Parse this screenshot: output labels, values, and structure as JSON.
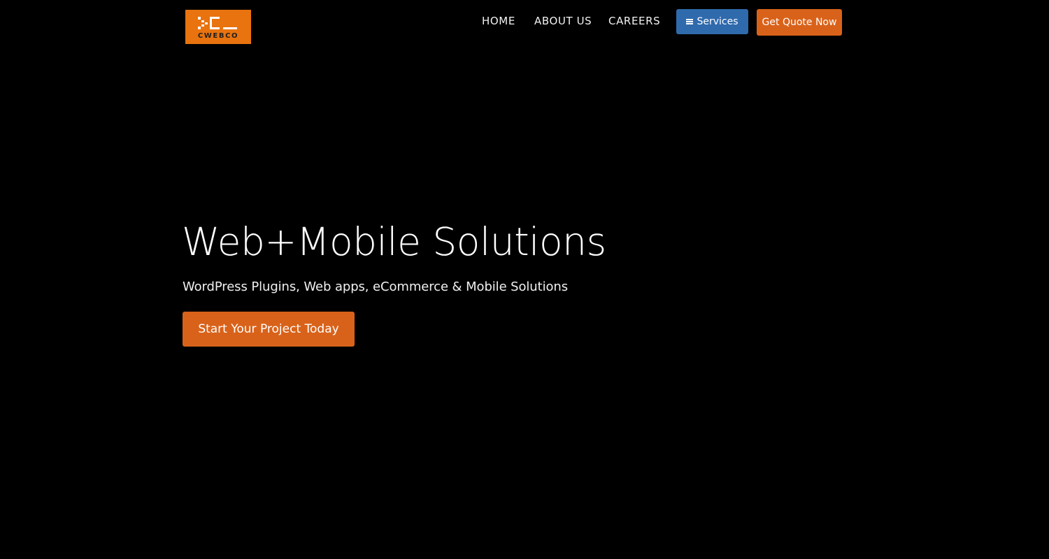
{
  "brand": {
    "logo_text": "CWEBCO",
    "logo_color": "#e8730f"
  },
  "nav": {
    "items": [
      {
        "label": "HOME"
      },
      {
        "label": "ABOUT US"
      },
      {
        "label": "CAREERS"
      }
    ],
    "services_label": "Services",
    "services_icon": "menu-icon",
    "quote_label": "Get Quote Now"
  },
  "hero": {
    "title": "Web+Mobile Solutions",
    "subtitle": "WordPress Plugins, Web apps, eCommerce & Mobile Solutions",
    "cta_label": "Start Your Project Today"
  },
  "colors": {
    "background": "#000000",
    "accent_orange": "#d9621a",
    "services_blue": "#2f6aad"
  }
}
